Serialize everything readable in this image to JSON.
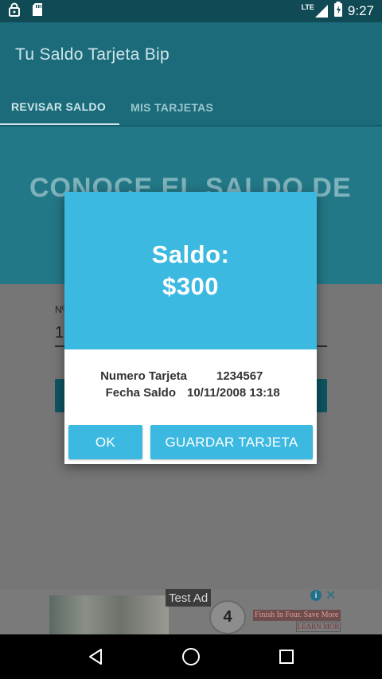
{
  "status_bar": {
    "time": "9:27",
    "network": "LTE"
  },
  "app": {
    "title": "Tu Saldo Tarjeta Bip",
    "tabs": [
      {
        "label": "REVISAR SALDO",
        "active": true
      },
      {
        "label": "MIS TARJETAS",
        "active": false
      }
    ]
  },
  "hero": {
    "text": "CONOCE EL SALDO DE"
  },
  "form": {
    "field_label": "Nº",
    "field_value": "1"
  },
  "dialog": {
    "title": "Saldo:",
    "amount": "$300",
    "card_number_label": "Numero Tarjeta",
    "card_number_value": "1234567",
    "date_label": "Fecha Saldo",
    "date_value": "10/11/2008 13:18",
    "ok_label": "OK",
    "save_label": "GUARDAR TARJETA"
  },
  "ad": {
    "tag": "Test Ad",
    "headline": "Finish In Four. Save More",
    "cta": "LEARN MOR",
    "logo_text": "4"
  },
  "colors": {
    "primary": "#1b6b7a",
    "accent": "#3cb9e0"
  }
}
